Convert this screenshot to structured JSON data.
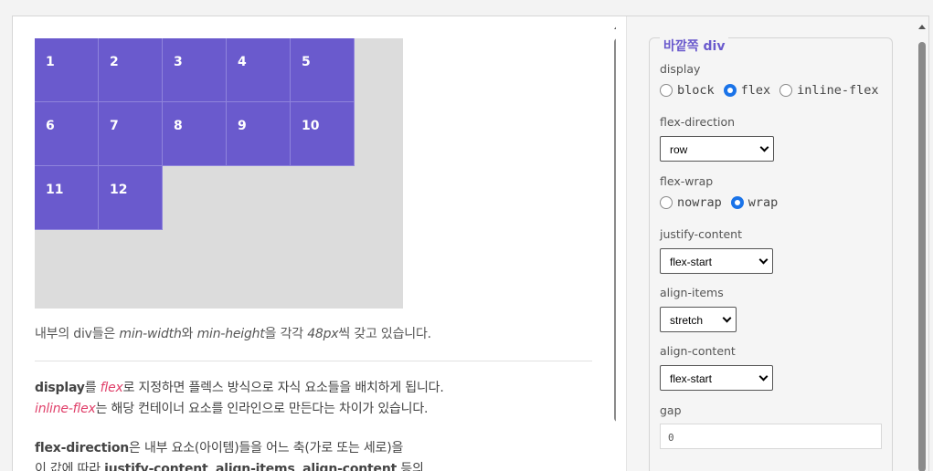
{
  "preview": {
    "items": [
      "1",
      "2",
      "3",
      "4",
      "5",
      "6",
      "7",
      "8",
      "9",
      "10",
      "11",
      "12"
    ],
    "note": {
      "p1": "내부의 div들은 ",
      "min_width": "min-width",
      "p2": "와 ",
      "min_height": "min-height",
      "p3": "을 각각 ",
      "size": "48px",
      "p4": "씩 갖고 있습니다."
    },
    "para1": {
      "display": "display",
      "t1": "를 ",
      "flex": "flex",
      "t2": "로 지정하면 플렉스 방식으로 자식 요소들을 배치하게 됩니다.",
      "inline_flex": "inline-flex",
      "t3": "는 해당 컨테이너 요소를 인라인으로 만든다는 차이가 있습니다."
    },
    "para2": {
      "flex_direction": "flex-direction",
      "t1": "은 내부 요소(아이템)들을 어느 축(가로 또는 세로)을",
      "t2": "이 값에 따라 ",
      "jc": "justify-content",
      "c1": ", ",
      "ai": "align-items",
      "c2": ", ",
      "ac": "align-content",
      "t3": " 등의"
    }
  },
  "panel": {
    "legend": "바깥쪽 div",
    "display": {
      "label": "display",
      "options": [
        "block",
        "flex",
        "inline-flex"
      ],
      "selected": "flex"
    },
    "flex_direction": {
      "label": "flex-direction",
      "value": "row"
    },
    "flex_wrap": {
      "label": "flex-wrap",
      "options": [
        "nowrap",
        "wrap"
      ],
      "selected": "wrap"
    },
    "justify_content": {
      "label": "justify-content",
      "value": "flex-start"
    },
    "align_items": {
      "label": "align-items",
      "value": "stretch"
    },
    "align_content": {
      "label": "align-content",
      "value": "flex-start"
    },
    "gap": {
      "label": "gap",
      "value": "0"
    }
  },
  "colors": {
    "item": "#6a5acd",
    "accent": "#6a5acd",
    "radio_on": "#1a73e8",
    "highlight": "#e0406a"
  }
}
